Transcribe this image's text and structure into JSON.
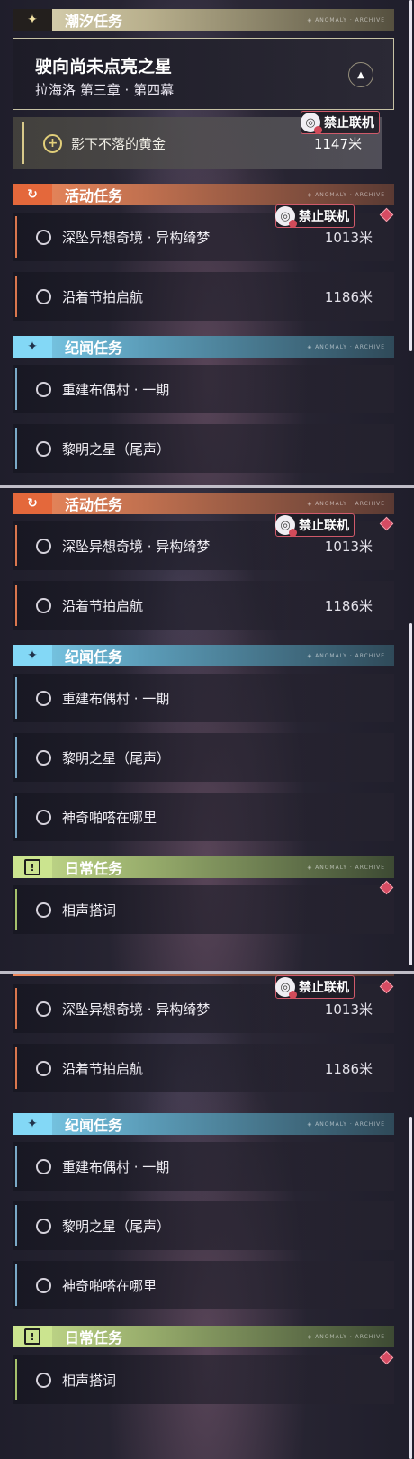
{
  "sections": {
    "tide": "潮汐任务",
    "activity": "活动任务",
    "lore": "纪闻任务",
    "daily": "日常任务"
  },
  "section_deco": "◈ ANOMALY · ARCHIVE",
  "icons": {
    "tide": "sparkle-icon",
    "activity": "cycle-icon",
    "lore": "sparkle-icon",
    "daily": "exclamation-icon",
    "no_online": "no-online-icon",
    "compass": "compass-icon",
    "plus": "plus-icon",
    "incomplete": "circle-icon",
    "alert": "diamond-alert-icon"
  },
  "main_quest": {
    "title": "驶向尚未点亮之星",
    "chapter": "拉海洛 第三章 · 第四幕"
  },
  "sub_quest": {
    "name": "影下不落的黄金",
    "distance": "1147米"
  },
  "no_online_label": "禁止联机",
  "activity_quests": [
    {
      "name": "深坠异想奇境 · 异构绮梦",
      "distance": "1013米"
    },
    {
      "name": "沿着节拍启航",
      "distance": "1186米"
    }
  ],
  "lore_quests": [
    {
      "name": "重建布偶村 · 一期"
    },
    {
      "name": "黎明之星（尾声）"
    },
    {
      "name": "神奇啪嗒在哪里"
    }
  ],
  "daily_quests": [
    {
      "name": "相声搭词"
    }
  ],
  "colors": {
    "tide": "#dcd5b4",
    "activity": "#f08a5d",
    "lore": "#7ed0ee",
    "daily": "#c8e08e",
    "alert": "#d64c63"
  }
}
